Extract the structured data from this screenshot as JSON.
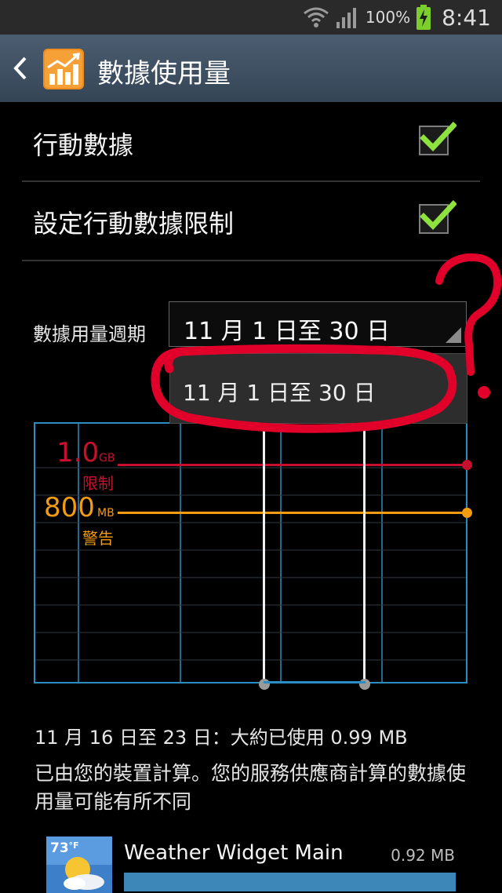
{
  "status_bar": {
    "battery": "100%",
    "time": "8:41"
  },
  "action_bar": {
    "title": "數據使用量"
  },
  "prefs": [
    {
      "label": "行動數據",
      "checked": true
    },
    {
      "label": "設定行動數據限制",
      "checked": true
    }
  ],
  "cycle": {
    "label": "數據用量週期",
    "selected": "11 月 1 日至 30 日",
    "options": [
      "11 月 1 日至 30 日"
    ]
  },
  "chart": {
    "limit": {
      "value": "1.0",
      "unit": "GB",
      "caption": "限制",
      "color": "#c8102e"
    },
    "warning": {
      "value": "800",
      "unit": "MB",
      "caption": "警告",
      "color": "#f39c12"
    },
    "grid_color": "#2a8ec4"
  },
  "summary": "11 月 16 日至 23 日：大約已使用 0.99 MB",
  "disclaimer": "已由您的裝置計算。您的服務供應商計算的數據使用量可能有所不同",
  "apps": [
    {
      "name": "Weather Widget Main",
      "size": "0.92 MB",
      "temp": "73",
      "temp_unit": "°F",
      "usage_fraction": 0.93
    }
  ]
}
